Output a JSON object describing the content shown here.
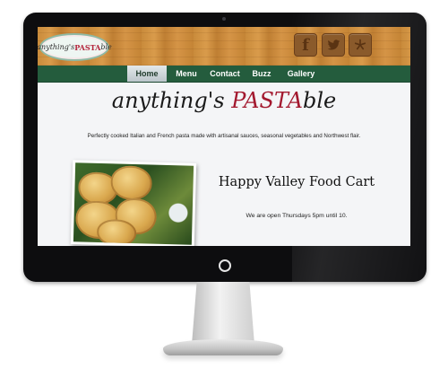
{
  "site": {
    "logo_text_prefix": "anything's ",
    "logo_text_accent": "PASTA",
    "logo_text_suffix": "ble",
    "title_prefix": "anything's ",
    "title_accent": "PASTA",
    "title_suffix": "ble",
    "tagline": "Perfectly cooked Italian and French pasta made with artisanal sauces, seasonal vegetables and Northwest flair."
  },
  "social": [
    {
      "name": "facebook",
      "glyph": "f"
    },
    {
      "name": "twitter",
      "glyph": "🐦"
    },
    {
      "name": "yelp",
      "glyph": "✱"
    }
  ],
  "nav": {
    "items": [
      "Home",
      "Menu",
      "Contact",
      "Buzz",
      "Gallery"
    ],
    "active": "Home"
  },
  "section": {
    "heading": "Happy Valley Food Cart",
    "hours": "We are open Thursdays 5pm until 10."
  },
  "colors": {
    "nav_bg": "#245c3d",
    "accent_red": "#a3192f",
    "header_wood": "#c98b3b"
  }
}
